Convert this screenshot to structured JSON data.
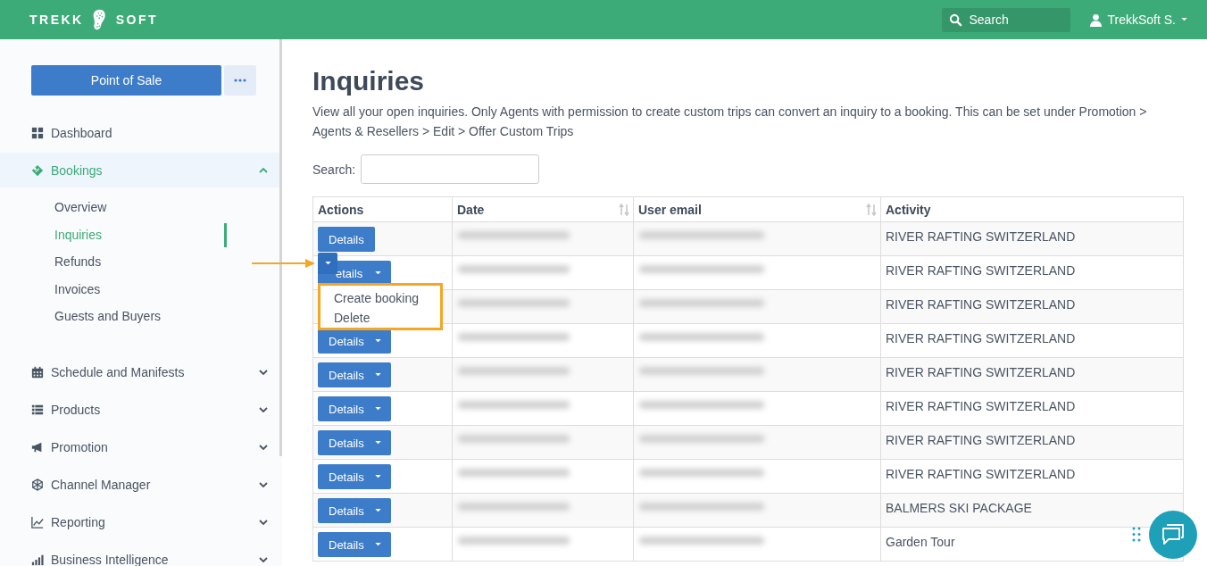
{
  "header": {
    "logo_left": "TREKK",
    "logo_right": "SOFT",
    "search": {
      "placeholder": "Search"
    },
    "user": {
      "name": "TrekkSoft S."
    }
  },
  "sidebar": {
    "pos_button": "Point of Sale",
    "items": [
      {
        "label": "Dashboard",
        "kind": "grid",
        "selected": false
      },
      {
        "label": "Bookings",
        "kind": "ticket",
        "selected": true,
        "expanded": true,
        "children": [
          {
            "label": "Overview",
            "selected": false
          },
          {
            "label": "Inquiries",
            "selected": true
          },
          {
            "label": "Refunds",
            "selected": false
          },
          {
            "label": "Invoices",
            "selected": false
          },
          {
            "label": "Guests and Buyers",
            "selected": false
          }
        ]
      },
      {
        "label": "Schedule and Manifests",
        "kind": "calendar",
        "selected": false,
        "expanded": false
      },
      {
        "label": "Products",
        "kind": "list",
        "selected": false,
        "expanded": false
      },
      {
        "label": "Promotion",
        "kind": "megaphone",
        "selected": false,
        "expanded": false
      },
      {
        "label": "Channel Manager",
        "kind": "hexagon",
        "selected": false,
        "expanded": false
      },
      {
        "label": "Reporting",
        "kind": "chart",
        "selected": false,
        "expanded": false
      },
      {
        "label": "Business Intelligence",
        "kind": "bars",
        "selected": false,
        "expanded": false
      }
    ]
  },
  "page": {
    "title": "Inquiries",
    "description": "View all your open inquiries. Only Agents with permission to create custom trips can convert an inquiry to a booking. This can be set under Promotion > Agents & Resellers > Edit > Offer Custom Trips",
    "search_label": "Search:",
    "table": {
      "columns": [
        {
          "label": "Actions",
          "sortable": false
        },
        {
          "label": "Date",
          "sortable": true
        },
        {
          "label": "User email",
          "sortable": true
        },
        {
          "label": "Activity",
          "sortable": false
        }
      ],
      "rows": [
        {
          "action": {
            "label": "Details",
            "split": false,
            "menu_open": false
          },
          "blurred": true,
          "activity": "RIVER RAFTING SWITZERLAND"
        },
        {
          "action": {
            "label": "etails",
            "split": true,
            "menu_open": true
          },
          "blurred": true,
          "activity": "RIVER RAFTING SWITZERLAND"
        },
        {
          "blurred": true,
          "activity": "RIVER RAFTING SWITZERLAND"
        },
        {
          "action": {
            "label": "Details",
            "split": true,
            "menu_open": false
          },
          "blurred": true,
          "activity": "RIVER RAFTING SWITZERLAND"
        },
        {
          "action": {
            "label": "Details",
            "split": true,
            "menu_open": false
          },
          "blurred": true,
          "activity": "RIVER RAFTING SWITZERLAND"
        },
        {
          "action": {
            "label": "Details",
            "split": true,
            "menu_open": false
          },
          "blurred": true,
          "activity": "RIVER RAFTING SWITZERLAND"
        },
        {
          "action": {
            "label": "Details",
            "split": true,
            "menu_open": false
          },
          "blurred": true,
          "activity": "RIVER RAFTING SWITZERLAND"
        },
        {
          "action": {
            "label": "Details",
            "split": true,
            "menu_open": false
          },
          "blurred": true,
          "activity": "RIVER RAFTING SWITZERLAND"
        },
        {
          "action": {
            "label": "Details",
            "split": true,
            "menu_open": false
          },
          "blurred": true,
          "activity": "BALMERS SKI PACKAGE"
        },
        {
          "action": {
            "label": "Details",
            "split": true,
            "menu_open": false
          },
          "blurred": true,
          "activity": "Garden Tour"
        }
      ]
    },
    "dropdown": {
      "items": [
        "Create booking",
        "Delete"
      ]
    }
  }
}
